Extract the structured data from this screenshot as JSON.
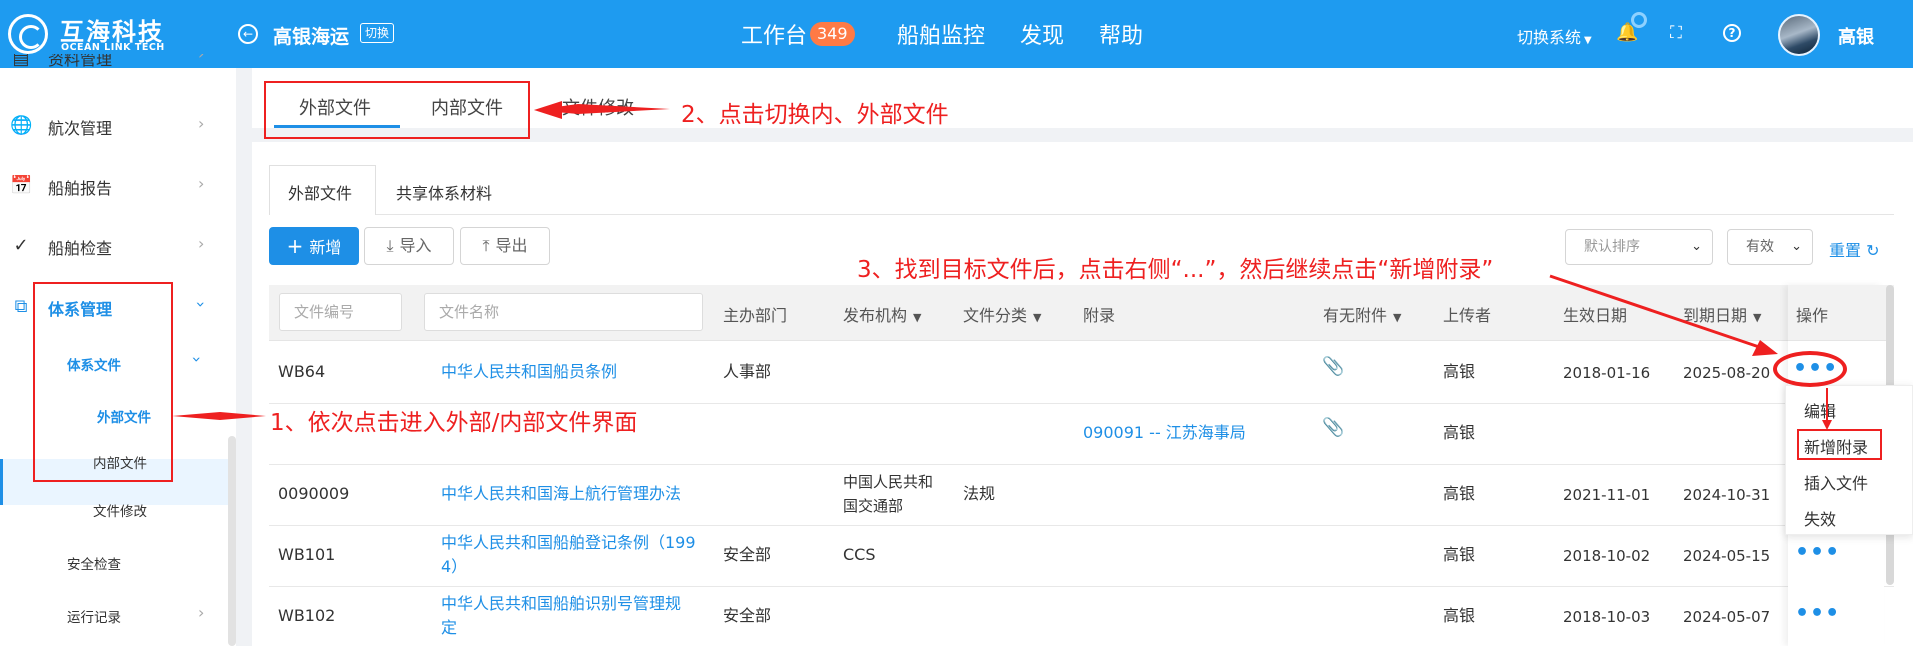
{
  "header": {
    "logo_name": "互海科技",
    "logo_sub": "OCEAN LINK TECH",
    "company": "高银海运",
    "switch_tag": "切换",
    "nav": [
      "工作台",
      "船舶监控",
      "发现",
      "帮助"
    ],
    "workbench_badge": "349",
    "switch_system": "切换系统",
    "user": "高银"
  },
  "sidebar": {
    "items": [
      {
        "label": "资料管理",
        "icon": "document-stack-icon"
      },
      {
        "label": "航次管理",
        "icon": "globe-icon"
      },
      {
        "label": "船舶报告",
        "icon": "calendar-icon"
      },
      {
        "label": "船舶检查",
        "icon": "check-circle-icon"
      },
      {
        "label": "体系管理",
        "icon": "file-copy-icon"
      }
    ],
    "sub": {
      "system_files": "体系文件",
      "external_files": "外部文件",
      "internal_files": "内部文件",
      "file_changes": "文件修改",
      "safety_check": "安全检查",
      "operation_records": "运行记录"
    }
  },
  "tabs": {
    "external": "外部文件",
    "internal": "内部文件",
    "changes": "文件修改"
  },
  "subtabs": {
    "external": "外部文件",
    "shared": "共享体系材料"
  },
  "toolbar": {
    "add": "新增",
    "import": "导入",
    "export": "导出",
    "sort_placeholder": "默认排序",
    "status_value": "有效",
    "reset": "重置"
  },
  "table": {
    "filter_code": "文件编号",
    "filter_name": "文件名称",
    "headers": {
      "dept": "主办部门",
      "publisher": "发布机构",
      "category": "文件分类",
      "appendix": "附录",
      "attach": "有无附件",
      "uploader": "上传者",
      "effective": "生效日期",
      "expire": "到期日期",
      "ops": "操作"
    },
    "rows": [
      {
        "code": "WB64",
        "name": "中华人民共和国船员条例",
        "dept": "人事部",
        "publisher": "",
        "category": "",
        "appendix": "",
        "uploader": "高银",
        "effective": "2018-01-16",
        "expire": "2025-08-20"
      },
      {
        "code": "",
        "name": "",
        "dept": "",
        "publisher": "",
        "category": "",
        "appendix": "090091 -- 江苏海事局",
        "uploader": "高银",
        "effective": "",
        "expire": ""
      },
      {
        "code": "0090009",
        "name": "中华人民共和国海上航行管理办法",
        "dept": "",
        "publisher_1": "中国人民共和",
        "publisher_2": "国交通部",
        "category": "法规",
        "appendix": "",
        "uploader": "高银",
        "effective": "2021-11-01",
        "expire": "2024-10-31"
      },
      {
        "code": "WB101",
        "name_1": "中华人民共和国船舶登记条例（199",
        "name_2": "4）",
        "dept": "安全部",
        "publisher": "CCS",
        "category": "",
        "appendix": "",
        "uploader": "高银",
        "effective": "2018-10-02",
        "expire": "2024-05-15"
      },
      {
        "code": "WB102",
        "name_1": "中华人民共和国船舶识别号管理规",
        "name_2": "定",
        "dept": "安全部",
        "publisher": "",
        "category": "",
        "appendix": "",
        "uploader": "高银",
        "effective": "2018-10-03",
        "expire": "2024-05-07"
      }
    ],
    "more": "•••"
  },
  "menu": [
    "编辑",
    "新增附录",
    "插入文件",
    "失效"
  ],
  "annotations": {
    "step1": "1、依次点击进入外部/内部文件界面",
    "step2": "2、点击切换内、外部文件",
    "step3": "3、找到目标文件后，点击右侧“...”，然后继续点击“新增附录”"
  },
  "colors": {
    "primary": "#1e8fe6",
    "header": "#1e9bf0",
    "annotation": "#ee2020",
    "badge": "#ff7a45"
  }
}
